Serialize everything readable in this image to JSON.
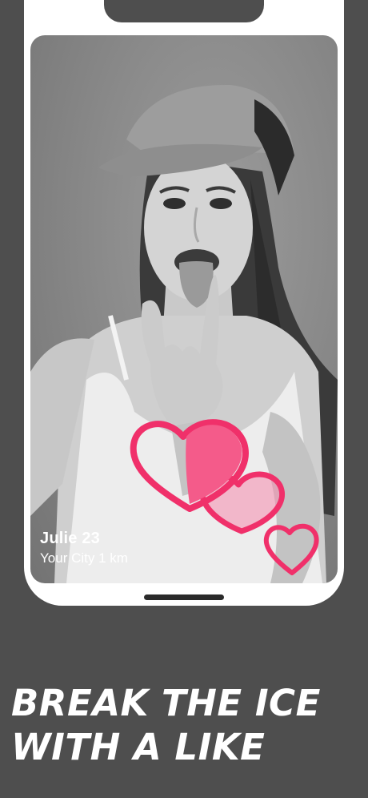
{
  "profile": {
    "name_age": "Julie 23",
    "location": "Your City 1 km"
  },
  "tagline": {
    "line1": "BREAK THE ICE",
    "line2": "WITH A LIKE"
  },
  "icons": [
    "heart-icon-large",
    "heart-icon-medium",
    "heart-icon-small"
  ],
  "colors": {
    "background": "#4e4e4e",
    "frame": "#ffffff",
    "heart_outline": "#f0306a",
    "heart_fill": "#f45b8a",
    "text": "#ffffff"
  }
}
